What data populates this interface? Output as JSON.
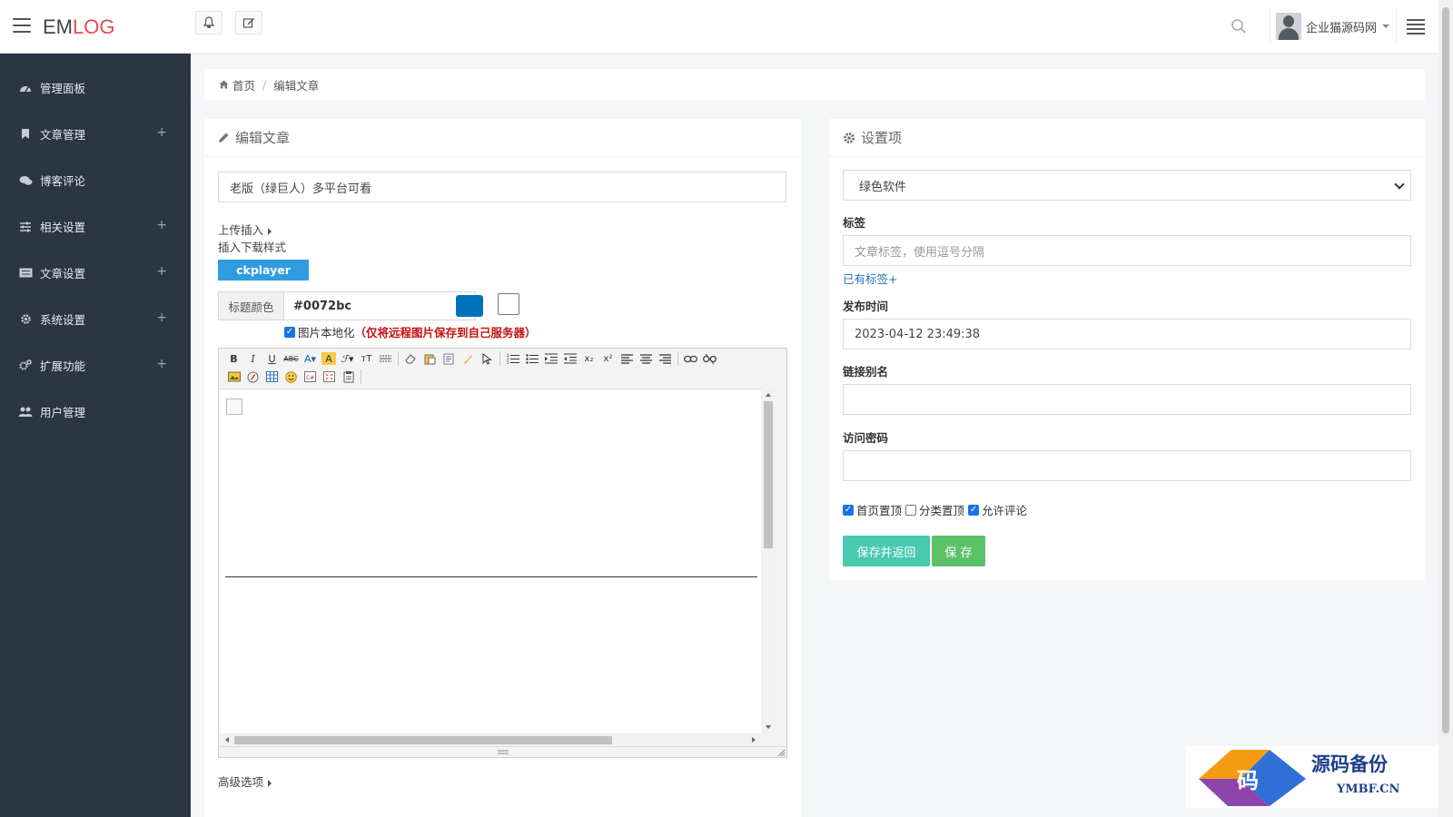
{
  "header": {
    "logo_em": "EM",
    "logo_log": "LOG",
    "user_name": "企业猫源码网"
  },
  "sidebar": {
    "items": [
      {
        "label": "管理面板",
        "icon": "dashboard-icon",
        "expandable": false
      },
      {
        "label": "文章管理",
        "icon": "bookmark-icon",
        "expandable": true
      },
      {
        "label": "博客评论",
        "icon": "comments-icon",
        "expandable": false
      },
      {
        "label": "相关设置",
        "icon": "sliders-icon",
        "expandable": true
      },
      {
        "label": "文章设置",
        "icon": "list-icon",
        "expandable": true
      },
      {
        "label": "系统设置",
        "icon": "gear-icon",
        "expandable": true
      },
      {
        "label": "扩展功能",
        "icon": "cogs-icon",
        "expandable": true
      },
      {
        "label": "用户管理",
        "icon": "users-icon",
        "expandable": false
      }
    ],
    "plus": "+"
  },
  "breadcrumb": {
    "home": "首页",
    "sep": "/",
    "current": "编辑文章"
  },
  "editor_panel": {
    "title": "编辑文章",
    "post_title_value": "老版（绿巨人）多平台可看",
    "upload_insert": "上传插入",
    "download_style": "插入下载样式",
    "ckplayer": "ckplayer",
    "title_color_label": "标题颜色",
    "title_color_value": "#0072bc",
    "title_color_swatch": "#0072bc",
    "localize_label": "图片本地化",
    "localize_note": "（仅将远程图片保存到自己服务器）",
    "advanced": "高级选项"
  },
  "settings_panel": {
    "title": "设置项",
    "category_value": "绿色软件",
    "tag_label": "标签",
    "tag_placeholder": "文章标签，使用逗号分隔",
    "existing_tags": "已有标签+",
    "publish_time_label": "发布时间",
    "publish_time_value": "2023-04-12 23:49:38",
    "alias_label": "链接别名",
    "alias_value": "",
    "password_label": "访问密码",
    "password_value": "",
    "check_home_top": "首页置顶",
    "check_home_top_on": true,
    "check_cat_top": "分类置顶",
    "check_cat_top_on": false,
    "check_allow_comment": "允许评论",
    "check_allow_comment_on": true,
    "save_return": "保存并返回",
    "save": "保 存"
  },
  "watermark": {
    "glyph": "码",
    "cn": "源码备份",
    "en": "YMBF.CN"
  },
  "colors": {
    "sidebar_bg": "#2b3643",
    "accent_blue": "#2f9ce0",
    "teal_button": "#48c9b0",
    "green_button": "#5cc26a",
    "warning_red": "#c41111"
  }
}
